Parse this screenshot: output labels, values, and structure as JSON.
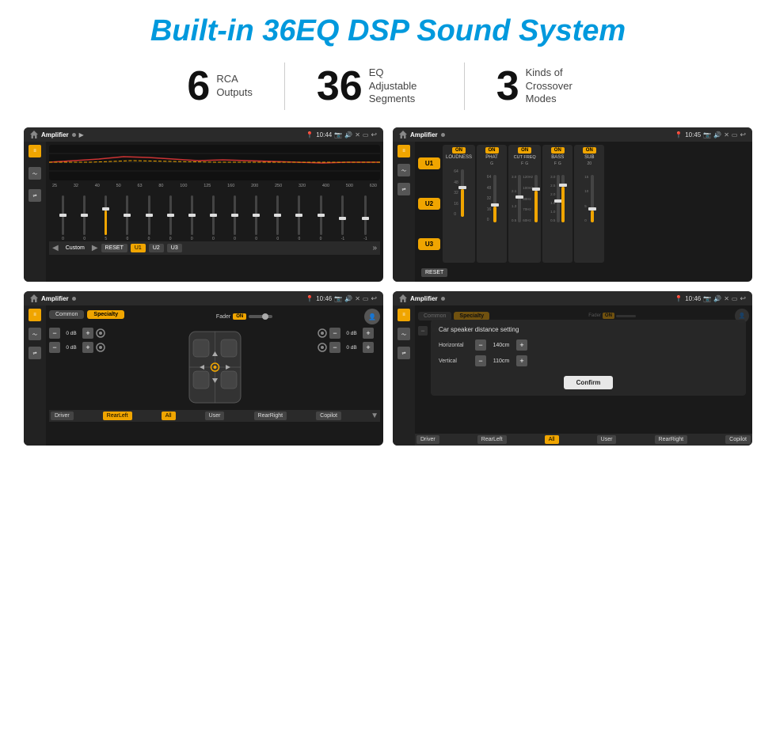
{
  "header": {
    "title": "Built-in 36EQ DSP Sound System"
  },
  "stats": [
    {
      "number": "6",
      "label": "RCA\nOutputs"
    },
    {
      "number": "36",
      "label": "EQ Adjustable\nSegments"
    },
    {
      "number": "3",
      "label": "Kinds of\nCrossover Modes"
    }
  ],
  "screens": [
    {
      "id": "screen1",
      "topbar": {
        "app": "Amplifier",
        "time": "10:44"
      }
    },
    {
      "id": "screen2",
      "topbar": {
        "app": "Amplifier",
        "time": "10:45"
      }
    },
    {
      "id": "screen3",
      "topbar": {
        "app": "Amplifier",
        "time": "10:46"
      }
    },
    {
      "id": "screen4",
      "topbar": {
        "app": "Amplifier",
        "time": "10:46"
      }
    }
  ],
  "eq": {
    "frequencies": [
      "25",
      "32",
      "40",
      "50",
      "63",
      "80",
      "100",
      "125",
      "160",
      "200",
      "250",
      "320",
      "400",
      "500",
      "630"
    ],
    "values": [
      "0",
      "0",
      "0",
      "5",
      "0",
      "0",
      "0",
      "0",
      "0",
      "0",
      "0",
      "0",
      "0",
      "-1",
      "-1"
    ],
    "buttons": {
      "custom": "Custom",
      "reset": "RESET",
      "u1": "U1",
      "u2": "U2",
      "u3": "U3"
    }
  },
  "channels": {
    "u_buttons": [
      "U1",
      "U2",
      "U3"
    ],
    "channel_labels": [
      "LOUDNESS",
      "PHAT",
      "CUT FREQ",
      "BASS",
      "SUB"
    ],
    "on_labels": [
      "ON",
      "ON",
      "ON",
      "ON",
      "ON"
    ],
    "reset": "RESET"
  },
  "fader": {
    "tabs": [
      "Common",
      "Specialty"
    ],
    "fader_label": "Fader",
    "on": "ON",
    "driver": "Driver",
    "rear_left": "RearLeft",
    "all": "All",
    "user": "User",
    "rear_right": "RearRight",
    "copilot": "Copilot"
  },
  "distance_dialog": {
    "title": "Car speaker distance setting",
    "horizontal_label": "Horizontal",
    "horizontal_value": "140cm",
    "vertical_label": "Vertical",
    "vertical_value": "110cm",
    "confirm": "Confirm",
    "tabs": [
      "Common",
      "Specialty"
    ],
    "on": "ON",
    "driver": "Driver",
    "rear_left": "RearLeft",
    "all": "All",
    "user": "User",
    "rear_right": "RearRight",
    "copilot": "Copilot"
  },
  "colors": {
    "accent": "#0099dd",
    "gold": "#f0a500",
    "dark_bg": "#1a1a1a",
    "sidebar_bg": "#222222"
  }
}
